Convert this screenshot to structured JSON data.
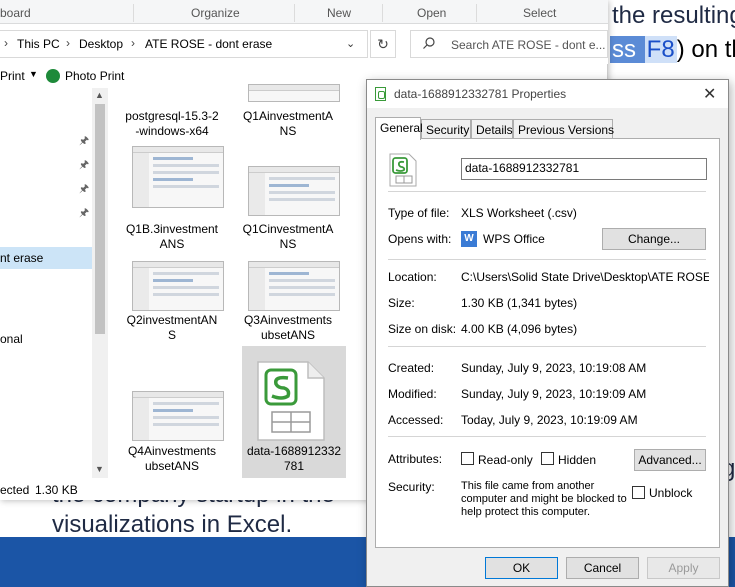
{
  "background_page": {
    "line1": "the resulting",
    "line2_pre": "ss ",
    "line2_key": "F8",
    "line2_post": ") on the",
    "line3": "C",
    "bottom_line1": "the company startup in the",
    "bottom_line2": "visualizations in Excel.",
    "right_fragment": "g"
  },
  "explorer": {
    "ribbon_groups": [
      "board",
      "Organize",
      "New",
      "Open",
      "Select"
    ],
    "breadcrumb": [
      "This PC",
      "Desktop",
      "ATE ROSE - dont erase"
    ],
    "search_placeholder": "Search ATE ROSE - dont e...",
    "commands": {
      "print": "Print",
      "photo_print": "Photo Print"
    },
    "nav": {
      "selected_label": "nt erase",
      "other_label": "onal"
    },
    "files": [
      {
        "name": "postgresql-15.3-2-windows-x64",
        "line1": "postgresql-15.3-2",
        "line2": "-windows-x64"
      },
      {
        "name": "Q1AinvestmentANS",
        "line1": "Q1AinvestmentA",
        "line2": "NS"
      },
      {
        "name": "Q1B.3investmentANS",
        "line1": "Q1B.3investment",
        "line2": "ANS"
      },
      {
        "name": "Q1CinvestmentANS",
        "line1": "Q1CinvestmentA",
        "line2": "NS"
      },
      {
        "name": "Q2investmentANS",
        "line1": "Q2investmentAN",
        "line2": "S"
      },
      {
        "name": "Q3AinvestmentsubsetANS",
        "line1": "Q3Ainvestments",
        "line2": "ubsetANS"
      },
      {
        "name": "Q4AinvestmentsubsetANS",
        "line1": "Q4Ainvestments",
        "line2": "ubsetANS"
      },
      {
        "name": "data-1688912332781",
        "line1": "data-1688912332",
        "line2": "781"
      }
    ],
    "status": {
      "selected": "ected",
      "size": "1.30 KB"
    }
  },
  "properties": {
    "title": "data-1688912332781 Properties",
    "tabs": [
      "General",
      "Security",
      "Details",
      "Previous Versions"
    ],
    "file_name": "data-1688912332781",
    "type_of_file_label": "Type of file:",
    "type_of_file": "XLS Worksheet (.csv)",
    "opens_with_label": "Opens with:",
    "opens_with": "WPS Office",
    "change_button": "Change...",
    "location_label": "Location:",
    "location": "C:\\Users\\Solid State Drive\\Desktop\\ATE ROSE - do",
    "size_label": "Size:",
    "size": "1.30 KB (1,341 bytes)",
    "size_on_disk_label": "Size on disk:",
    "size_on_disk": "4.00 KB (4,096 bytes)",
    "created_label": "Created:",
    "created": "Sunday, July 9, 2023, 10:19:08 AM",
    "modified_label": "Modified:",
    "modified": "Sunday, July 9, 2023, 10:19:09 AM",
    "accessed_label": "Accessed:",
    "accessed": "Today, July 9, 2023, 10:19:09 AM",
    "attributes_label": "Attributes:",
    "readonly_label": "Read-only",
    "hidden_label": "Hidden",
    "advanced_button": "Advanced...",
    "security_label": "Security:",
    "security_text": "This file came from another computer and might be blocked to help protect this computer.",
    "unblock_label": "Unblock",
    "ok": "OK",
    "cancel": "Cancel",
    "apply": "Apply"
  },
  "colors": {
    "accent": "#0078d7",
    "selection": "#cce4f7",
    "page_band": "#1b55a6",
    "wps_green": "#3a9a3a"
  },
  "icons": [
    "search-icon",
    "refresh-icon",
    "chevron-down-icon",
    "pin-icon",
    "photo-print-icon",
    "spreadsheet-file-icon",
    "wps-office-icon",
    "close-icon"
  ]
}
